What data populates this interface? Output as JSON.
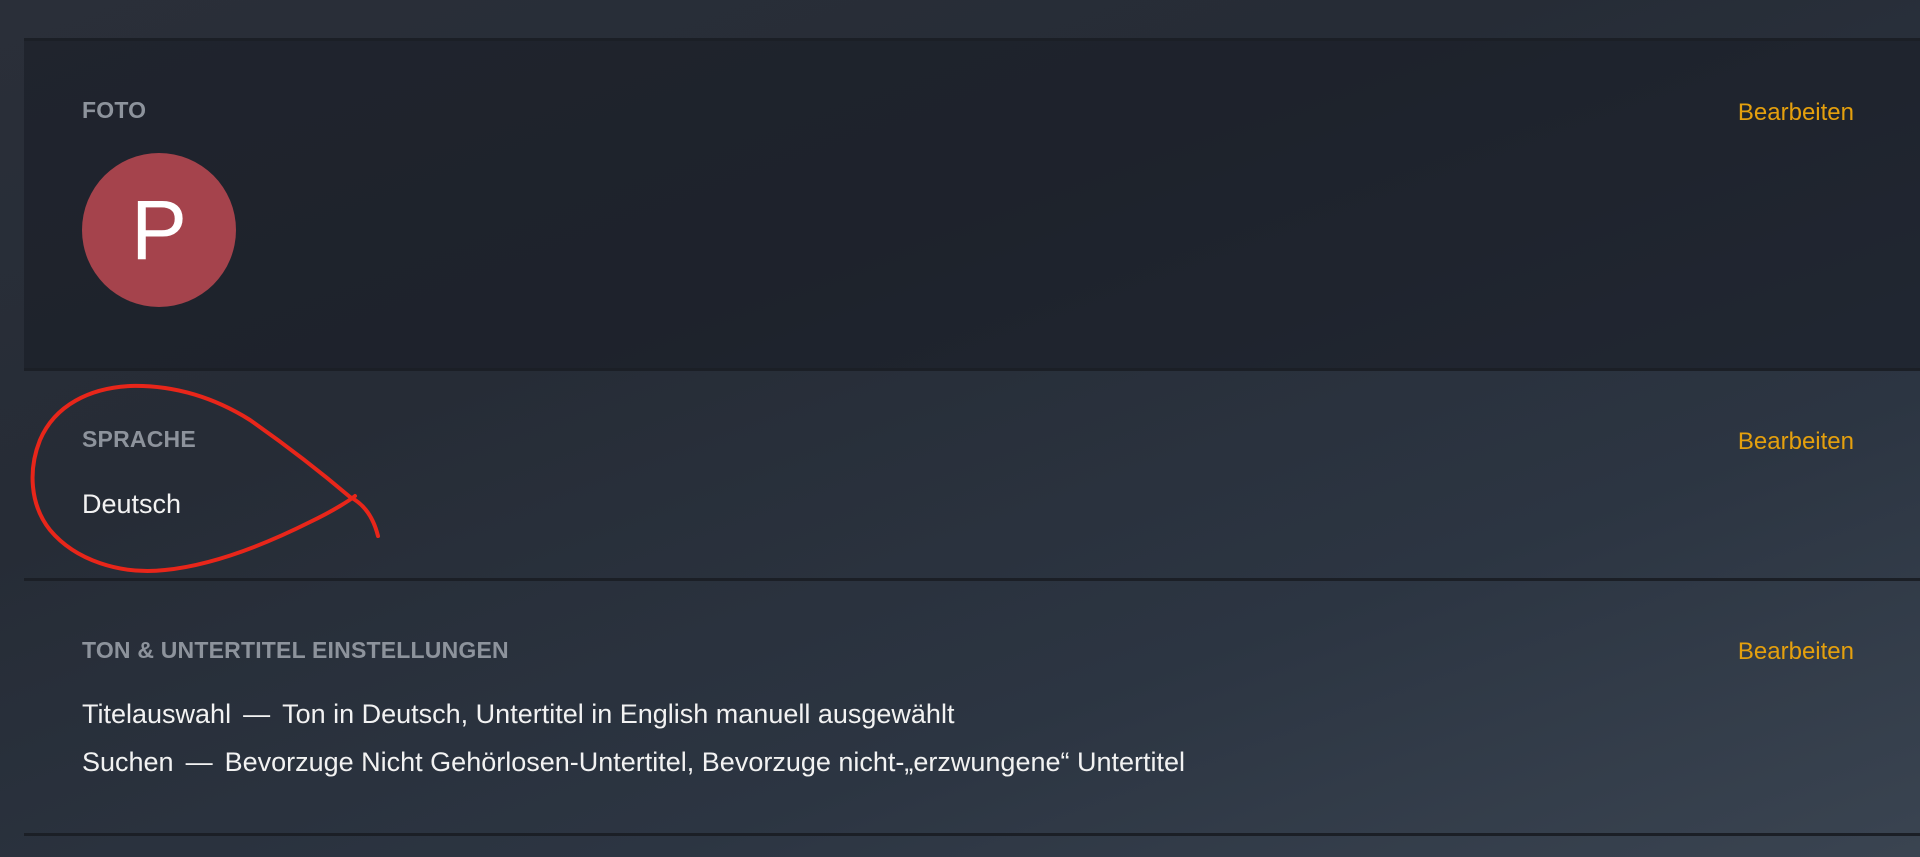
{
  "photo_section": {
    "title": "FOTO",
    "edit_label": "Bearbeiten",
    "avatar_letter": "P",
    "avatar_color": "#a5434c"
  },
  "language_section": {
    "title": "SPRACHE",
    "edit_label": "Bearbeiten",
    "value": "Deutsch"
  },
  "audio_subtitle_section": {
    "title": "TON & UNTERTITEL EINSTELLUNGEN",
    "edit_label": "Bearbeiten",
    "rows": [
      {
        "label": "Titelauswahl",
        "separator": "—",
        "value": "Ton in Deutsch, Untertitel in English manuell ausgewählt"
      },
      {
        "label": "Suchen",
        "separator": "—",
        "value": "Bevorzuge Nicht Gehörlosen-Untertitel, Bevorzuge nicht-„erzwungene“ Untertitel"
      }
    ]
  },
  "colors": {
    "accent": "#e5a00d",
    "annotation": "#e8261a",
    "label_gray": "#8d939c"
  }
}
